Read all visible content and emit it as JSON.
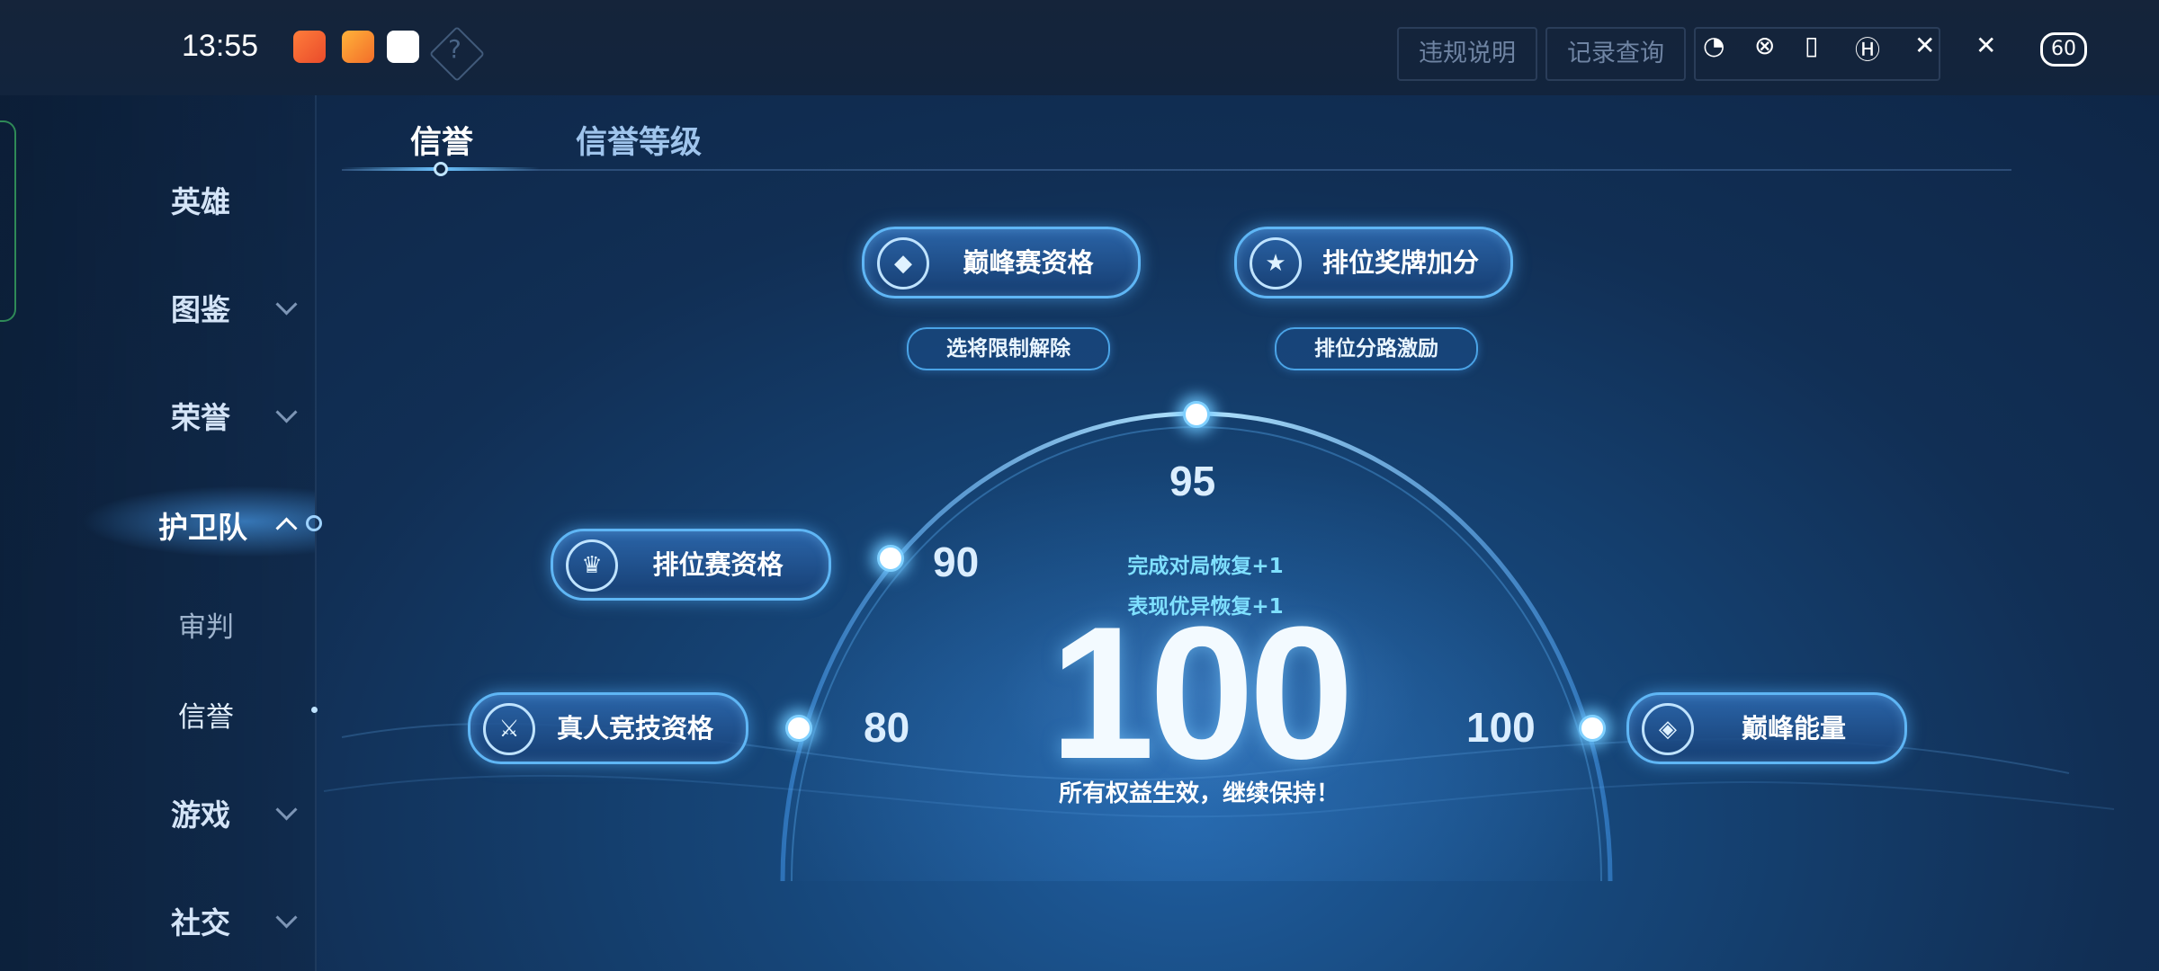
{
  "status_bar": {
    "time": "13:55",
    "battery": "60"
  },
  "header": {
    "buttons": [
      "违规说明",
      "记录查询"
    ]
  },
  "sidebar": {
    "items": [
      {
        "label": "英雄",
        "expandable": false
      },
      {
        "label": "图鉴",
        "expandable": true
      },
      {
        "label": "荣誉",
        "expandable": true
      },
      {
        "label": "护卫队",
        "expandable": true,
        "active": true
      },
      {
        "label": "审判",
        "sub": true
      },
      {
        "label": "信誉",
        "sub": true,
        "selected": true
      },
      {
        "label": "游戏",
        "expandable": true
      },
      {
        "label": "社交",
        "expandable": true
      }
    ]
  },
  "tabs": [
    {
      "label": "信誉",
      "active": true
    },
    {
      "label": "信誉等级",
      "active": false
    }
  ],
  "benefits": {
    "peak_qualification": "巅峰赛资格",
    "rank_medal_bonus": "排位奖牌加分",
    "pick_limit_removed": "选将限制解除",
    "rank_lane_incentive": "排位分路激励",
    "ranked_qualification": "排位赛资格",
    "real_player_qualification": "真人竞技资格",
    "peak_energy": "巅峰能量"
  },
  "thresholds": {
    "t80": "80",
    "t90": "90",
    "t95": "95",
    "t100": "100"
  },
  "score": {
    "value": "100",
    "recover_match": "完成对局恢复+1",
    "recover_performance": "表现优异恢复+1",
    "status": "所有权益生效，继续保持！"
  },
  "colors": {
    "accent": "#5fb6f5",
    "glow": "#7fd0ff",
    "recover_text": "#7fe0ff"
  }
}
